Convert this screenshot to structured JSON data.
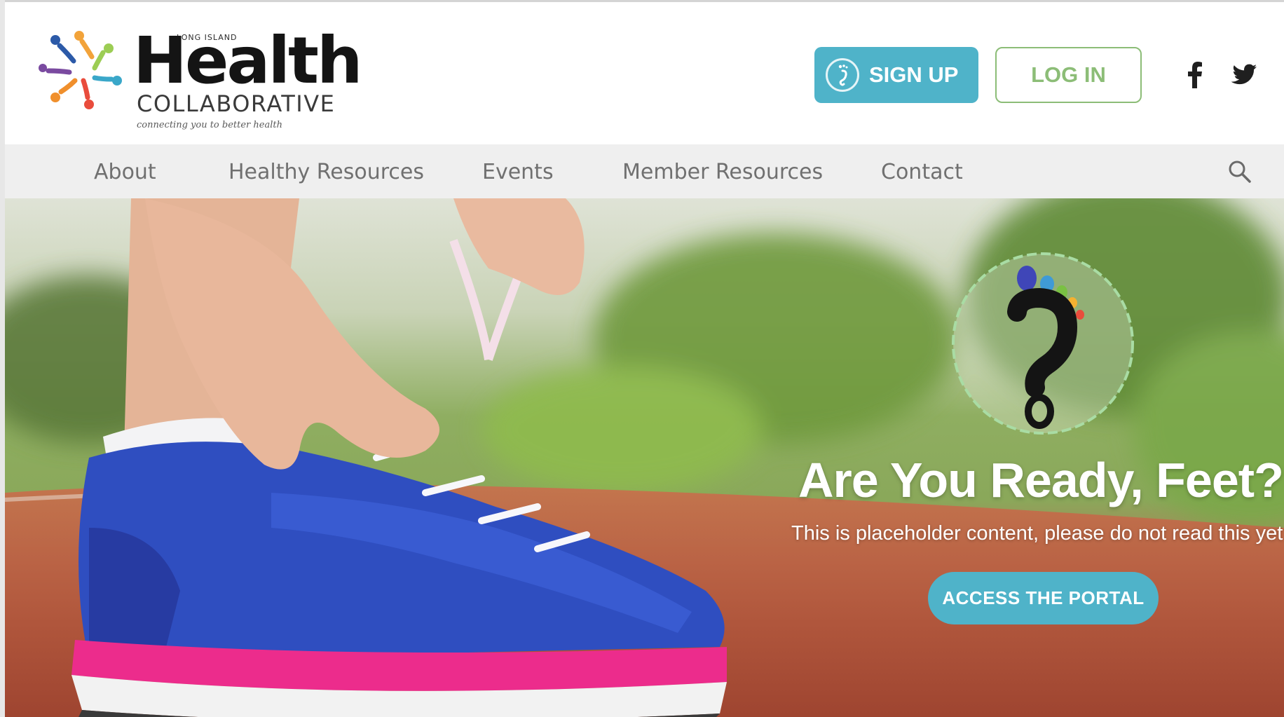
{
  "brand": {
    "region": "LONG ISLAND",
    "name": "Health",
    "sub": "COLLABORATIVE",
    "tagline": "connecting you to better health"
  },
  "header": {
    "signup_label": "SIGN UP",
    "login_label": "LOG IN"
  },
  "nav": {
    "items": [
      "About",
      "Healthy Resources",
      "Events",
      "Member Resources",
      "Contact"
    ]
  },
  "hero": {
    "title": "Are You Ready, Feet?",
    "subtitle": "This is placeholder content, please do not read this yet",
    "cta_label": "ACCESS THE PORTAL"
  },
  "colors": {
    "accent": "#4fb3c9",
    "login_green": "#8cbd77",
    "nav_bg": "#efefef"
  },
  "icons": [
    "logo-mark-icon",
    "footprint-icon",
    "facebook-icon",
    "twitter-icon",
    "search-icon",
    "feet-question-badge-icon"
  ]
}
